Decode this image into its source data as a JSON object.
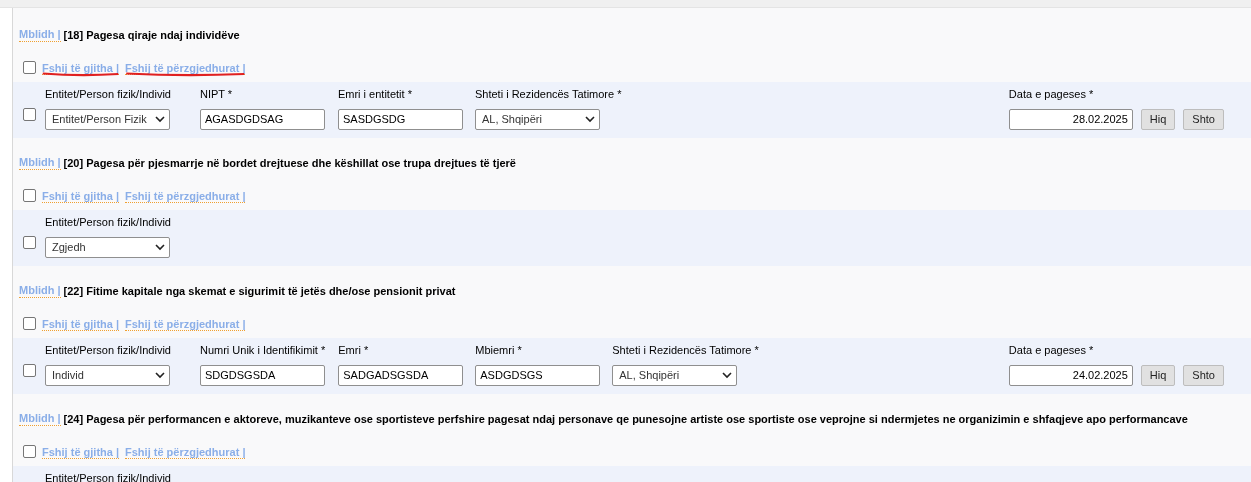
{
  "sections": [
    {
      "toggle": "Mblidh |",
      "title": "[18] Pagesa qiraje ndaj individëve",
      "select_all_checked": false,
      "links": [
        {
          "label": "Fshij të gjitha |",
          "marked": true
        },
        {
          "label": "Fshij të përzgjedhurat |",
          "marked": true
        }
      ],
      "rows": [
        {
          "checked": false,
          "fields": [
            {
              "kind": "select",
              "label": "Entitet/Person fizik/Individ",
              "value": "Entitet/Person Fizik"
            },
            {
              "kind": "text",
              "label": "NIPT *",
              "value": "AGASDGDSAG"
            },
            {
              "kind": "text",
              "label": "Emri i entitetit *",
              "value": "SASDGSDG"
            },
            {
              "kind": "select",
              "label": "Shteti i Rezidencës Tatimore *",
              "value": "AL, Shqipëri"
            }
          ],
          "date": {
            "label": "Data e pageses *",
            "value": "28.02.2025"
          },
          "buttons": [
            "Hiq",
            "Shto"
          ]
        }
      ]
    },
    {
      "toggle": "Mblidh |",
      "title": "[20] Pagesa për pjesmarrje në bordet drejtuese dhe këshillat ose trupa drejtues të tjerë",
      "select_all_checked": false,
      "links": [
        {
          "label": "Fshij të gjitha |",
          "marked": false
        },
        {
          "label": "Fshij të përzgjedhurat |",
          "marked": false
        }
      ],
      "rows": [
        {
          "checked": false,
          "fields": [
            {
              "kind": "select",
              "label": "Entitet/Person fizik/Individ",
              "value": "Zgjedh"
            }
          ]
        }
      ]
    },
    {
      "toggle": "Mblidh |",
      "title": "[22] Fitime kapitale nga skemat e sigurimit të jetës dhe/ose pensionit privat",
      "select_all_checked": false,
      "links": [
        {
          "label": "Fshij të gjitha |",
          "marked": false
        },
        {
          "label": "Fshij të përzgjedhurat |",
          "marked": false
        }
      ],
      "rows": [
        {
          "checked": false,
          "fields": [
            {
              "kind": "select",
              "label": "Entitet/Person fizik/Individ",
              "value": "Individ"
            },
            {
              "kind": "text",
              "label": "Numri Unik i Identifikimit *",
              "value": "SDGDSGSDA"
            },
            {
              "kind": "text",
              "label": "Emri *",
              "value": "SADGADSGSDA"
            },
            {
              "kind": "text",
              "label": "Mbiemri *",
              "value": "ASDGDSGS"
            },
            {
              "kind": "select",
              "label": "Shteti i Rezidencës Tatimore *",
              "value": "AL, Shqipëri"
            }
          ],
          "date": {
            "label": "Data e pageses *",
            "value": "24.02.2025"
          },
          "buttons": [
            "Hiq",
            "Shto"
          ]
        }
      ]
    },
    {
      "toggle": "Mblidh |",
      "title": "[24] Pagesa për performancen e aktoreve, muzikanteve ose sportisteve perfshire pagesat ndaj personave qe punesojne artiste ose sportiste ose veprojne si ndermjetes ne organizimin e shfaqjeve apo performancave",
      "select_all_checked": false,
      "links": [
        {
          "label": "Fshij të gjitha |",
          "marked": false
        },
        {
          "label": "Fshij të përzgjedhurat |",
          "marked": false
        }
      ],
      "rows": [
        {
          "fields": [
            {
              "kind": "select",
              "label": "Entitet/Person fizik/Individ"
            }
          ]
        }
      ]
    }
  ]
}
